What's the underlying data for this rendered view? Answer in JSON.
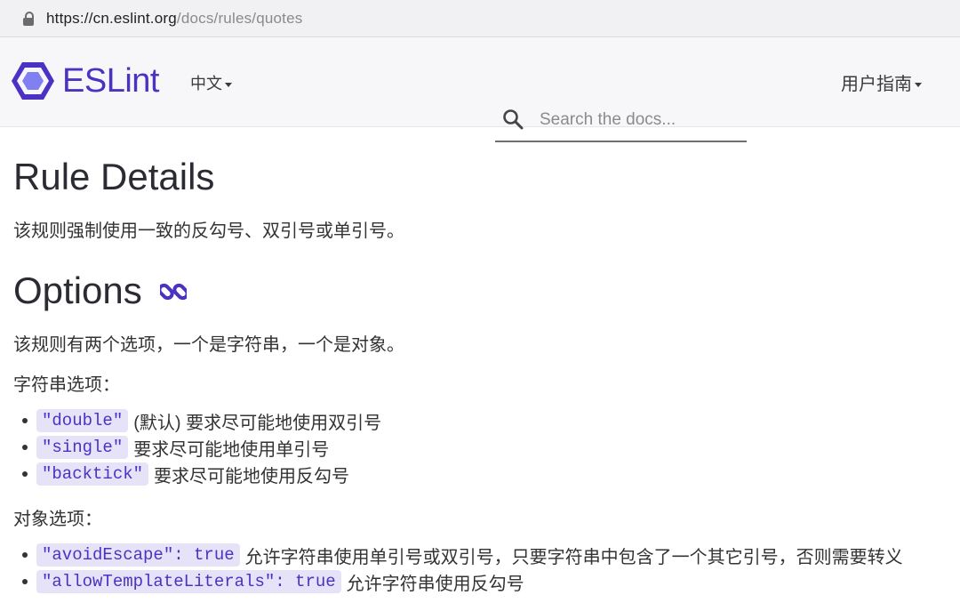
{
  "browser": {
    "url_domain": "https://cn.eslint.org",
    "url_path": "/docs/rules/quotes"
  },
  "header": {
    "logo_text": "ESLint",
    "language": "中文",
    "search_placeholder": "Search the docs...",
    "guide_menu": "用户指南"
  },
  "content": {
    "rule_details_title": "Rule Details",
    "rule_details_desc": "该规则强制使用一致的反勾号、双引号或单引号。",
    "options_title": "Options",
    "options_desc": "该规则有两个选项，一个是字符串，一个是对象。",
    "string_options_label": "字符串选项：",
    "string_options": [
      {
        "code": "\"double\"",
        "text": "(默认) 要求尽可能地使用双引号"
      },
      {
        "code": "\"single\"",
        "text": "要求尽可能地使用单引号"
      },
      {
        "code": "\"backtick\"",
        "text": "要求尽可能地使用反勾号"
      }
    ],
    "object_options_label": "对象选项：",
    "object_options": [
      {
        "code": "\"avoidEscape\": true",
        "text": "允许字符串使用单引号或双引号，只要字符串中包含了一个其它引号，否则需要转义"
      },
      {
        "code": "\"allowTemplateLiterals\": true",
        "text": "允许字符串使用反勾号"
      }
    ]
  },
  "colors": {
    "brand": "#4b32c3",
    "code_bg": "#e6e3f9"
  }
}
